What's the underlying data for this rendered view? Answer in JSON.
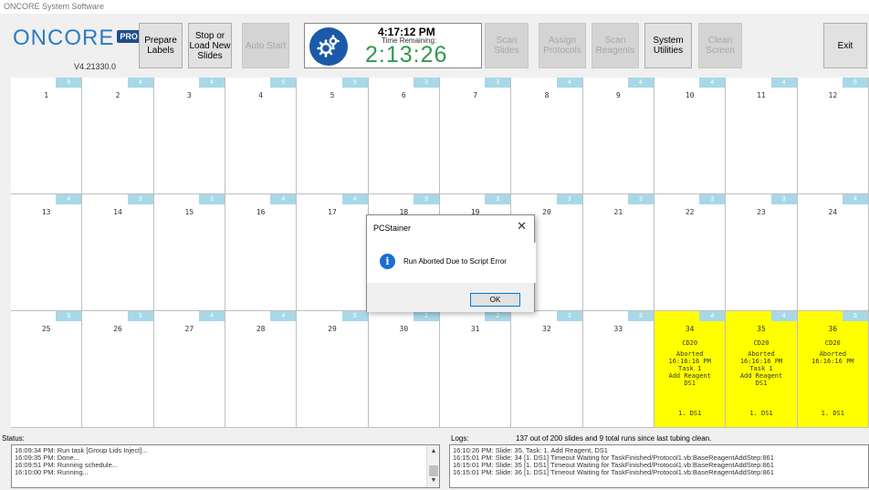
{
  "window": {
    "title": "ONCORE System Software"
  },
  "logo": {
    "text": "ONCORE",
    "badge": "PRO",
    "version": "V4.21330.0"
  },
  "toolbar": {
    "prepare_labels": "Prepare\nLabels",
    "stop_load": "Stop or\nLoad New\nSlides",
    "auto_start": "Auto Start",
    "scan_slides": "Scan\nSlides",
    "assign_protocols": "Assign\nProtocols",
    "scan_reagents": "Scan\nReagents",
    "system_utilities": "System\nUtilities",
    "clean_screen": "Clean\nScreen",
    "exit": "Exit"
  },
  "clock": {
    "time": "4:17:12 PM",
    "label": "Time Remaining:",
    "remaining": "2:13:26",
    "accent": "#2e9a4e",
    "icon": "gears-icon"
  },
  "slots": [
    {
      "num": "1",
      "badge": "6"
    },
    {
      "num": "2",
      "badge": "4"
    },
    {
      "num": "3",
      "badge": "4"
    },
    {
      "num": "4",
      "badge": "5"
    },
    {
      "num": "5",
      "badge": "5"
    },
    {
      "num": "6",
      "badge": "3"
    },
    {
      "num": "7",
      "badge": "3"
    },
    {
      "num": "8",
      "badge": "4"
    },
    {
      "num": "9",
      "badge": "4"
    },
    {
      "num": "10",
      "badge": "4"
    },
    {
      "num": "11",
      "badge": "4"
    },
    {
      "num": "12",
      "badge": "6"
    },
    {
      "num": "13",
      "badge": "4"
    },
    {
      "num": "14",
      "badge": "3"
    },
    {
      "num": "15",
      "badge": "3"
    },
    {
      "num": "16",
      "badge": "4"
    },
    {
      "num": "17",
      "badge": "4"
    },
    {
      "num": "18",
      "badge": "3"
    },
    {
      "num": "19",
      "badge": "3"
    },
    {
      "num": "20",
      "badge": "3"
    },
    {
      "num": "21",
      "badge": "3"
    },
    {
      "num": "22",
      "badge": "3"
    },
    {
      "num": "23",
      "badge": "3"
    },
    {
      "num": "24",
      "badge": "4"
    },
    {
      "num": "25",
      "badge": "5"
    },
    {
      "num": "26",
      "badge": "3"
    },
    {
      "num": "27",
      "badge": "4"
    },
    {
      "num": "28",
      "badge": "4"
    },
    {
      "num": "29",
      "badge": "5"
    },
    {
      "num": "30",
      "badge": "2"
    },
    {
      "num": "31",
      "badge": "2"
    },
    {
      "num": "32",
      "badge": "3"
    },
    {
      "num": "33",
      "badge": "3"
    },
    {
      "num": "34",
      "badge": "4",
      "highlight": true,
      "detail": "CD20",
      "reagent": "Aborted\n16:16:16 PM\nTask 1\nAdd Reagent\nDS1",
      "foot": "1. DS1"
    },
    {
      "num": "35",
      "badge": "4",
      "highlight": true,
      "detail": "CD20",
      "reagent": "Aborted\n16:16:16 PM\nTask 1\nAdd Reagent\nDS1",
      "foot": "1. DS1"
    },
    {
      "num": "36",
      "badge": "6",
      "highlight": true,
      "detail": "CD20",
      "reagent": "Aborted\n16:16:16 PM",
      "foot": "1. DS1"
    }
  ],
  "colors": {
    "highlight": "#ffff00",
    "badge": "#a8d8e8"
  },
  "dialog": {
    "title": "PCStainer",
    "message": "Run Aborted Due to Script Error",
    "ok": "OK",
    "icon": "info-icon"
  },
  "status": {
    "label": "Status:",
    "lines": [
      "16:09:34 PM: Run task [Group Lids Inject]...",
      "16:09:35 PM: Done...",
      "16:09:51 PM: Running schedule...",
      "16:10:00 PM: Running..."
    ]
  },
  "logs": {
    "label": "Logs:",
    "summary": "137 out of 200 slides and  9  total runs since last tubing clean.",
    "lines": [
      "16:10:26 PM: Slide: 35, Task: 1. Add Reagent, DS1",
      "16:15:01 PM: Slide: 34 [1. DS1] Timeout Waiting for TaskFinished/Protocol1.vb:BaseReagentAddStep:861",
      "16:15:01 PM: Slide: 35 [1. DS1] Timeout Waiting for TaskFinished/Protocol1.vb:BaseReagentAddStep:861",
      "16:15:01 PM: Slide: 36 [1. DS1] Timeout Waiting for TaskFinished/Protocol1.vb:BaseReagentAddStep:861"
    ]
  }
}
